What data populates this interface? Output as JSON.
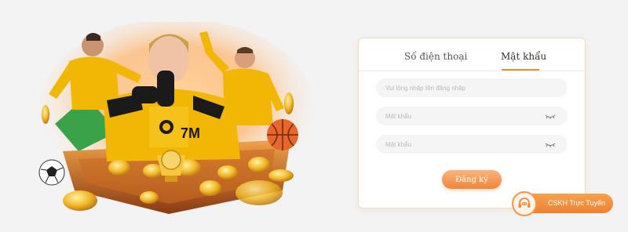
{
  "login": {
    "tabs": [
      {
        "label": "Số điện thoại",
        "active": false
      },
      {
        "label": "Mật khẩu",
        "active": true
      }
    ],
    "username_placeholder": "Vui lòng nhập tên đăng nhập",
    "password_placeholder": "Mật khẩu",
    "confirm_placeholder": "Mật khẩu",
    "submit_label": "Đăng ký"
  },
  "support": {
    "label": "CSKH Trực Tuyến",
    "icon": "headset-chat-icon"
  },
  "promo": {
    "jersey_text": "7M",
    "icons": [
      "soccer-ball-icon",
      "basketball-icon",
      "gold-coin-icon",
      "gold-cup-icon"
    ]
  },
  "colors": {
    "accent": "#f08a3c",
    "jersey": "#f2b705",
    "background": "#f3f3f3"
  }
}
